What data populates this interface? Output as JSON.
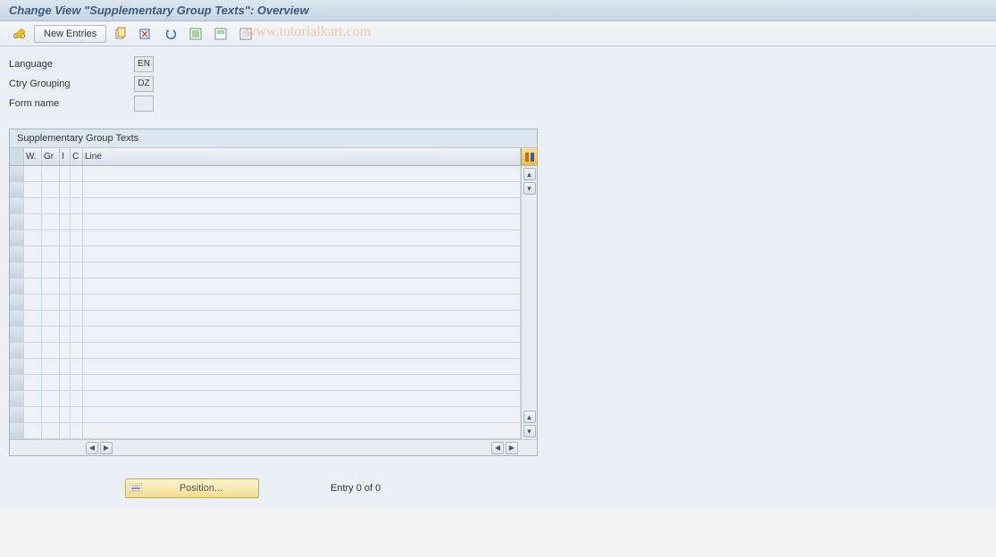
{
  "header": {
    "title": "Change View \"Supplementary Group Texts\": Overview"
  },
  "toolbar": {
    "new_entries_label": "New Entries",
    "watermark": "www.tutorialkart.com"
  },
  "form": {
    "language": {
      "label": "Language",
      "value": "EN"
    },
    "ctry_grouping": {
      "label": "Ctry Grouping",
      "value": "DZ"
    },
    "form_name": {
      "label": "Form name",
      "value": ""
    }
  },
  "table": {
    "title": "Supplementary Group Texts",
    "columns": {
      "w": "W.",
      "gr": "Gr",
      "i": "I",
      "c": "C",
      "line": "Line"
    },
    "rows": []
  },
  "footer": {
    "position_label": "Position...",
    "entry_text": "Entry 0 of 0"
  }
}
